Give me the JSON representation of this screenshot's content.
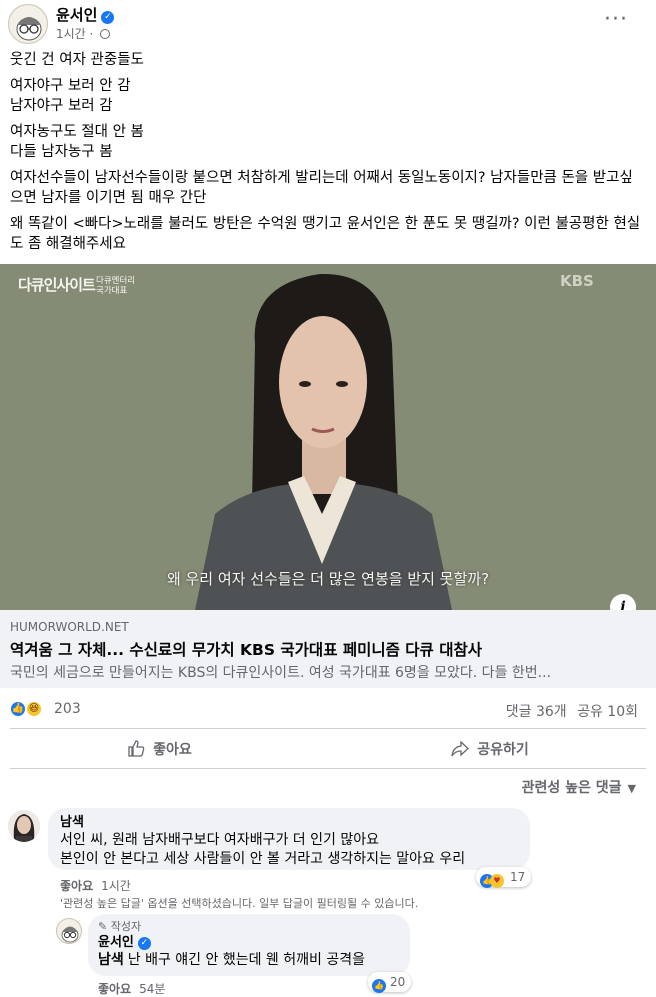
{
  "post": {
    "author": "윤서인",
    "time": "1시간 · ",
    "paragraphs": [
      "웃긴 건 여자 관중들도",
      "여자야구 보러 안 감\n남자야구 보러 감",
      "여자농구도 절대 안 봄\n다들 남자농구 봄",
      "여자선수들이 남자선수들이랑 붙으면 처참하게 발리는데 어째서 동일노동이지? 남자들만큼 돈을 받고싶으면 남자를 이기면 됨 매우 간단",
      "왜 똑같이 <빠다>노래를 불러도 방탄은 수억원 땡기고 윤서인은 한 푼도 못 땡길까? 이런 불공평한 현실도 좀 해결해주세요"
    ]
  },
  "media": {
    "logo": "다큐인사이트",
    "logo_sub": "다큐멘터리\n국가대표",
    "watermark": "KBS",
    "subtitle": "왜 우리 여자 선수들은 더 많은 연봉을 받지 못할까?"
  },
  "link": {
    "domain": "HUMORWORLD.NET",
    "title": "역겨움 그 자체... 수신료의 무가치 KBS 국가대표 페미니즘 다큐 대참사",
    "description": "국민의 세금으로 만들어지는 KBS의 다큐인사이트. 여성 국가대표 6명을 모았다. 다들 한번..."
  },
  "stats": {
    "reactions": "203",
    "comments": "댓글 36개",
    "shares": "공유 10회"
  },
  "actions": {
    "like": "좋아요",
    "share": "공유하기"
  },
  "comments_sort": "관련성 높은 댓글",
  "comment1": {
    "name": "남색",
    "text": "서인 씨, 원래 남자배구보다 여자배구가 더 인기 많아요\n본인이 안 본다고 세상 사람들이 안 볼 거라고 생각하지는 말아요 우리",
    "like": "좋아요",
    "time": "1시간",
    "reactions": "17"
  },
  "filter_note": "'관련성 높은 답글' 옵션을 선택하셨습니다. 일부 답글이 필터링될 수 있습니다.",
  "reply1": {
    "badge": "작성자",
    "name": "윤서인",
    "mention": "남색",
    "text": "난 배구 얘긴 안 했는데 웬 허깨비 공격을",
    "like": "좋아요",
    "time": "54분",
    "reactions": "20"
  },
  "colors": {
    "accent": "#1877f2",
    "secondary_text": "#65676b",
    "bubble": "#f0f2f5",
    "media_bg": "#858c75"
  }
}
